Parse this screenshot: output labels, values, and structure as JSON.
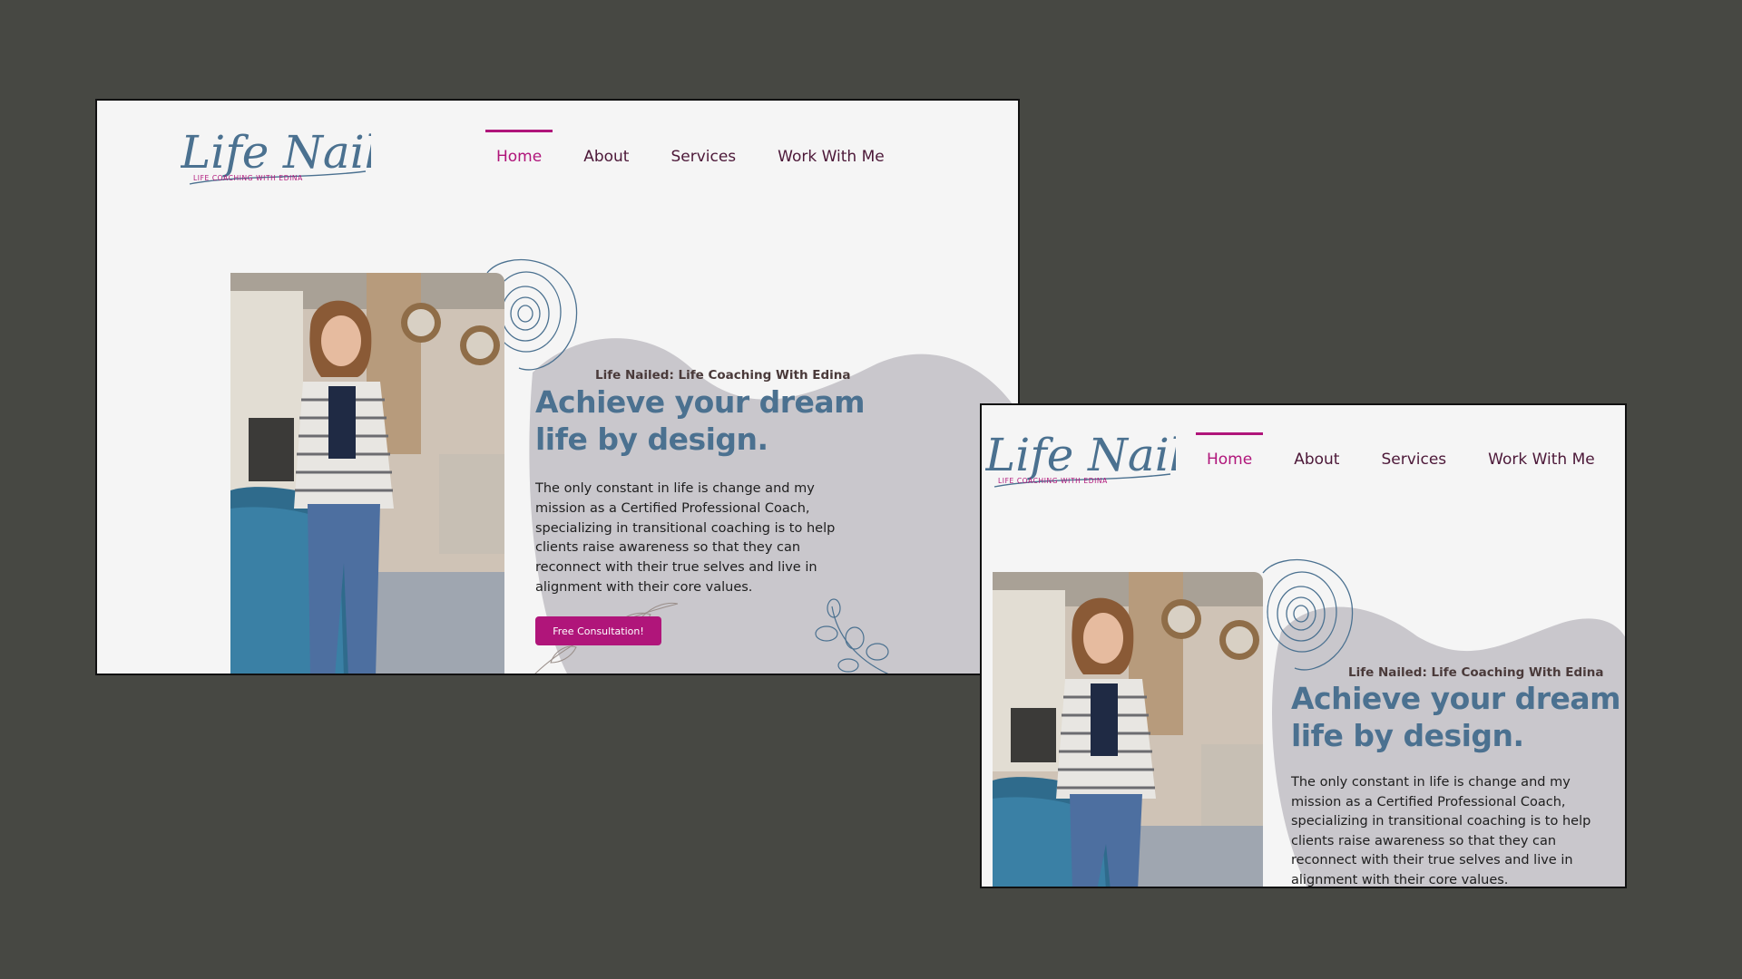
{
  "brand": {
    "logo_script": "Life Nailed",
    "logo_tagline": "LIFE COACHING WITH EDINA"
  },
  "nav": {
    "items": [
      {
        "label": "Home",
        "active": true
      },
      {
        "label": "About"
      },
      {
        "label": "Services"
      },
      {
        "label": "Work With Me"
      }
    ]
  },
  "hero": {
    "subtitle": "Life Nailed: Life Coaching With Edina",
    "title_line1": "Achieve your dream",
    "title_line2": "life by design.",
    "body_lines": [
      "The only constant in life is change and my",
      "mission as a Certified Professional Coach,",
      "specializing in transitional coaching is to help",
      "clients raise awareness so that they can",
      "reconnect with their true selves and live in",
      "alignment with their core values."
    ],
    "cta_label": "Free Consultation!"
  },
  "colors": {
    "page_bg": "#474843",
    "frame_bg": "#f5f5f5",
    "blob": "#c9c7cc",
    "accent": "#b0157a",
    "title": "#4b7190",
    "nav_text": "#4c1838"
  }
}
